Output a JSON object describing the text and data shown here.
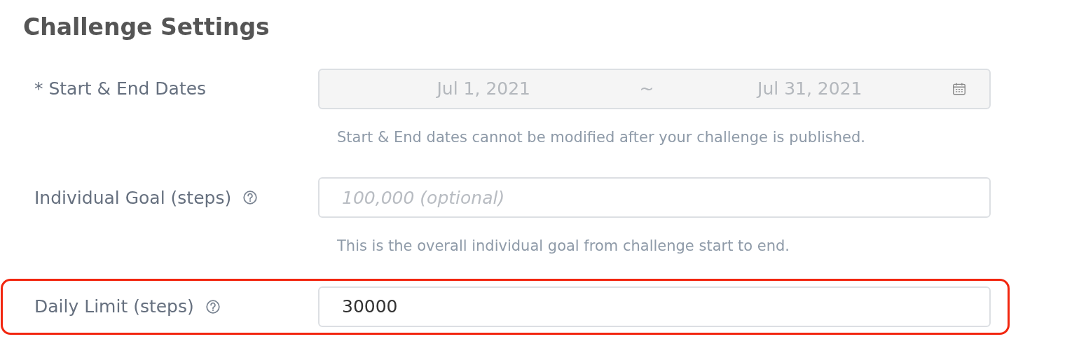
{
  "title": "Challenge Settings",
  "fields": [
    {
      "kind": "daterange",
      "label": "* Start & End Dates",
      "start": "Jul 1, 2021",
      "separator": "~",
      "end": "Jul 31, 2021",
      "disabled": true,
      "hint": "Start & End dates cannot be modified after your challenge is published."
    },
    {
      "kind": "text",
      "label": "Individual Goal (steps)",
      "help_icon": true,
      "placeholder": "100,000 (optional)",
      "hint": "This is the overall individual goal from challenge start to end."
    },
    {
      "kind": "text",
      "label": "Daily Limit (steps)",
      "help_icon": true,
      "value": "30000",
      "highlighted": true
    }
  ]
}
